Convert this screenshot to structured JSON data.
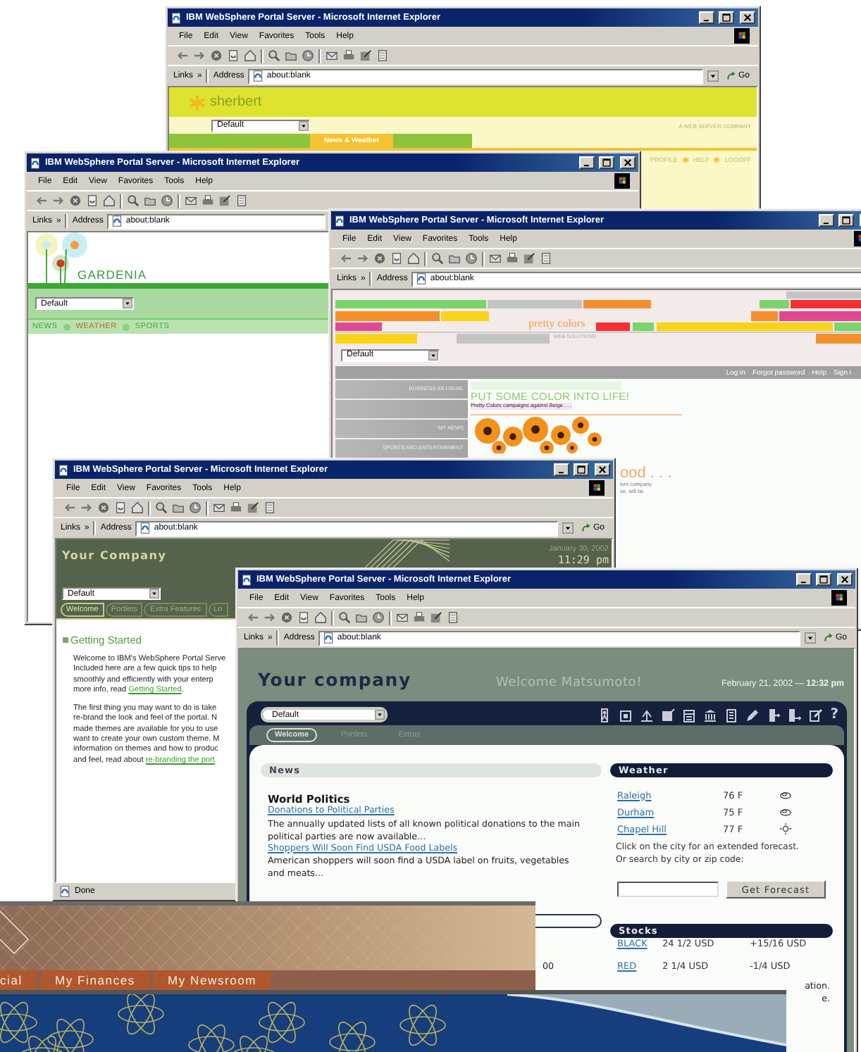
{
  "windows": [
    {
      "kind": "browser",
      "title": "IBM WebSphere Portal Server - Microsoft Internet Explorer",
      "menu": [
        "File",
        "Edit",
        "View",
        "Favorites",
        "Tools",
        "Help"
      ],
      "links_label": "Links",
      "links_more": "»",
      "address_label": "Address",
      "address": "about:blank",
      "go": "Go",
      "page": {
        "kind": "sherbert",
        "brand": "sherbert",
        "theme_select": "Default",
        "tagline": "A WEB SERVER COMPANY",
        "tabs": [
          {
            "label": "News & Weather",
            "selected": true
          }
        ],
        "links": [
          "PROFILE",
          "HELP",
          "LOGOFF"
        ]
      }
    },
    {
      "kind": "browser",
      "title": "IBM WebSphere Portal Server - Microsoft Internet Explorer",
      "menu": [
        "File",
        "Edit",
        "View",
        "Favorites",
        "Tools",
        "Help"
      ],
      "links_label": "Links",
      "links_more": "»",
      "address_label": "Address",
      "address": "about:blank",
      "page": {
        "kind": "gardenia",
        "brand": "GARDENIA",
        "theme_select": "Default",
        "nav": [
          {
            "label": "NEWS",
            "selected": false
          },
          {
            "label": "WEATHER",
            "selected": true
          },
          {
            "label": "SPORTS",
            "selected": false
          }
        ]
      }
    },
    {
      "kind": "browser",
      "title": "IBM WebSphere Portal Server - Microsoft Internet Explorer",
      "menu": [
        "File",
        "Edit",
        "View",
        "Favorites",
        "Tools",
        "Help"
      ],
      "links_label": "Links",
      "links_more": "»",
      "address_label": "Address",
      "address": "about:blank",
      "page": {
        "kind": "pretty",
        "brand": "pretty colors",
        "tagline": "WEB SOLUTIONS",
        "theme_select": "Default",
        "top_links": [
          "Log in",
          "Forgot password",
          "Help",
          "Sign i"
        ],
        "nav": [
          {
            "kind": "link",
            "label": "BUSINESS AS USUAL"
          },
          {
            "kind": "spacer"
          },
          {
            "kind": "link",
            "label": "MY NEWS"
          },
          {
            "kind": "link",
            "label": "SPORTS AND ENTERTAINMENT"
          }
        ],
        "headline": "PUT SOME COLOR INTO LIFE!",
        "subline": "Pretty Colors campaigns against Beige . . .",
        "heading2": "ood . . .",
        "text_lines": [
          "lors company",
          "se, will be"
        ]
      }
    },
    {
      "kind": "browser",
      "title": "IBM WebSphere Portal Server - Microsoft Internet Explorer",
      "menu": [
        "File",
        "Edit",
        "View",
        "Favorites",
        "Tools",
        "Help"
      ],
      "links_label": "Links",
      "links_more": "»",
      "address_label": "Address",
      "address": "about:blank",
      "go": "Go",
      "status": "Done",
      "page": {
        "kind": "company_green",
        "brand": "Your Company",
        "date": "January 30, 2002",
        "time": "11:29 pm",
        "theme_select": "Default",
        "tabs": [
          {
            "label": "Welcome",
            "selected": true
          },
          {
            "label": "Portlets",
            "selected": false
          },
          {
            "label": "Extra Features",
            "selected": false
          },
          {
            "label": "Lo",
            "selected": false
          }
        ],
        "section_title": "Getting Started",
        "paragraphs": [
          [
            {
              "text": "Welcome to IBM's WebSphere Portal Serve"
            },
            {
              "text": "Included here are a few quick tips to help"
            },
            {
              "text": "smoothly and efficiently with your enterp"
            },
            {
              "text": "more info, read ",
              "link": "Getting Started",
              "after": "."
            }
          ],
          [
            {
              "text": "The first thing you may want to do is take"
            },
            {
              "text": "re-brand the look and feel of the portal. N"
            },
            {
              "text": "made themes are available for you to use"
            },
            {
              "text": "want to create your own custom theme. M"
            },
            {
              "text": "information on themes and how to produc"
            },
            {
              "text": "and feel, read about ",
              "link": "re-branding the port"
            }
          ]
        ]
      }
    },
    {
      "kind": "browser",
      "title": "IBM WebSphere Portal Server - Microsoft Internet Explorer",
      "menu": [
        "File",
        "Edit",
        "View",
        "Favorites",
        "Tools",
        "Help"
      ],
      "links_label": "Links",
      "links_more": "»",
      "address_label": "Address",
      "address": "about:blank",
      "go": "Go",
      "page": {
        "kind": "company_blue",
        "brand": "Your company",
        "greeting": "Welcome Matsumoto!",
        "date": "February 21, 2002 — **12:32 pm**",
        "theme_select": "Default",
        "help": "?",
        "tabs": [
          {
            "label": "Welcome",
            "selected": true
          },
          {
            "label": "Portlets",
            "selected": false
          },
          {
            "label": "Extras",
            "selected": false
          }
        ],
        "news": {
          "title": "News",
          "category": "World Politics",
          "items": [
            {
              "link": "Donations to Political Parties",
              "text": "The annually updated lists of all known political donations to the main political parties are now available..."
            },
            {
              "link": "Shoppers Will Soon Find USDA Food Labels",
              "text": "American shoppers will soon find a USDA label on fruits, vegetables and meats..."
            }
          ],
          "fragment": "00"
        },
        "weather": {
          "title": "Weather",
          "cities": [
            {
              "city": "Raleigh",
              "temp": "76 F",
              "kind": "cloudy"
            },
            {
              "city": "Durham",
              "temp": "75 F",
              "kind": "cloudy"
            },
            {
              "city": "Chapel Hill",
              "temp": "77 F",
              "kind": "sunny"
            }
          ],
          "hint": [
            "Click on the city for an extended forecast.",
            "Or search by city or zip code:"
          ],
          "button": "Get Forecast"
        },
        "stocks": {
          "title": "Stocks",
          "rows": [
            {
              "symbol": "BLACK",
              "price": "24 1/2 USD",
              "change": "+15/16 USD"
            },
            {
              "symbol": "RED",
              "price": "2 1/4 USD",
              "change": "-1/4 USD"
            }
          ],
          "fragments": [
            "ation.",
            "e."
          ]
        }
      }
    },
    {
      "kind": "brown_banner",
      "tabs": [
        "cial",
        "My Finances",
        "My Newsroom"
      ]
    },
    {
      "kind": "atom_banner"
    }
  ]
}
